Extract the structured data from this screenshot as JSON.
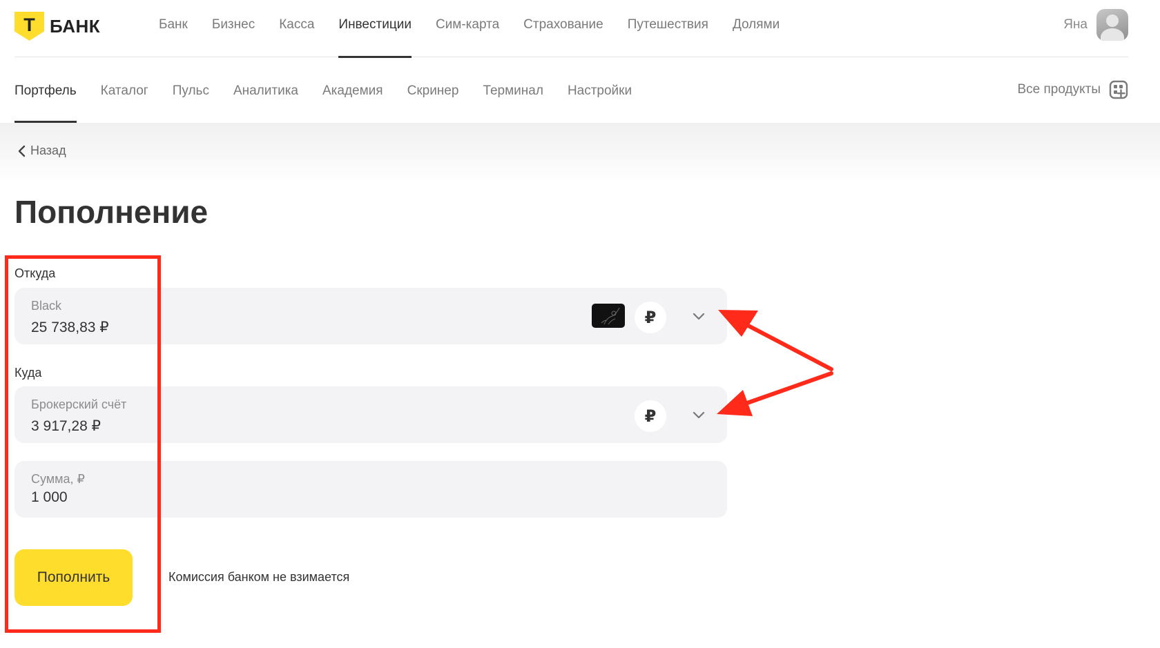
{
  "brand": {
    "logo_letter": "Т",
    "logo_text": "БАНК",
    "accent": "#ffdd2d"
  },
  "main_nav": {
    "items": [
      {
        "label": "Банк"
      },
      {
        "label": "Бизнес"
      },
      {
        "label": "Касса"
      },
      {
        "label": "Инвестиции",
        "active": true
      },
      {
        "label": "Сим-карта"
      },
      {
        "label": "Страхование"
      },
      {
        "label": "Путешествия"
      },
      {
        "label": "Долями"
      }
    ]
  },
  "user": {
    "name": "Яна"
  },
  "sub_nav": {
    "items": [
      {
        "label": "Портфель",
        "active": true
      },
      {
        "label": "Каталог"
      },
      {
        "label": "Пульс"
      },
      {
        "label": "Аналитика"
      },
      {
        "label": "Академия"
      },
      {
        "label": "Скринер"
      },
      {
        "label": "Терминал"
      },
      {
        "label": "Настройки"
      }
    ],
    "all_products": "Все продукты"
  },
  "back_label": "Назад",
  "page_title": "Пополнение",
  "form": {
    "from": {
      "label": "Откуда",
      "account_name": "Black",
      "balance": "25 738,83 ₽",
      "currency_symbol": "₽"
    },
    "to": {
      "label": "Куда",
      "account_name": "Брокерский счёт",
      "balance": "3 917,28 ₽",
      "currency_symbol": "₽"
    },
    "amount": {
      "caption": "Сумма, ₽",
      "value": "1 000"
    },
    "submit_label": "Пополнить",
    "commission_note": "Комиссия банком не взимается"
  },
  "annotation_color": "#ff2a1a"
}
